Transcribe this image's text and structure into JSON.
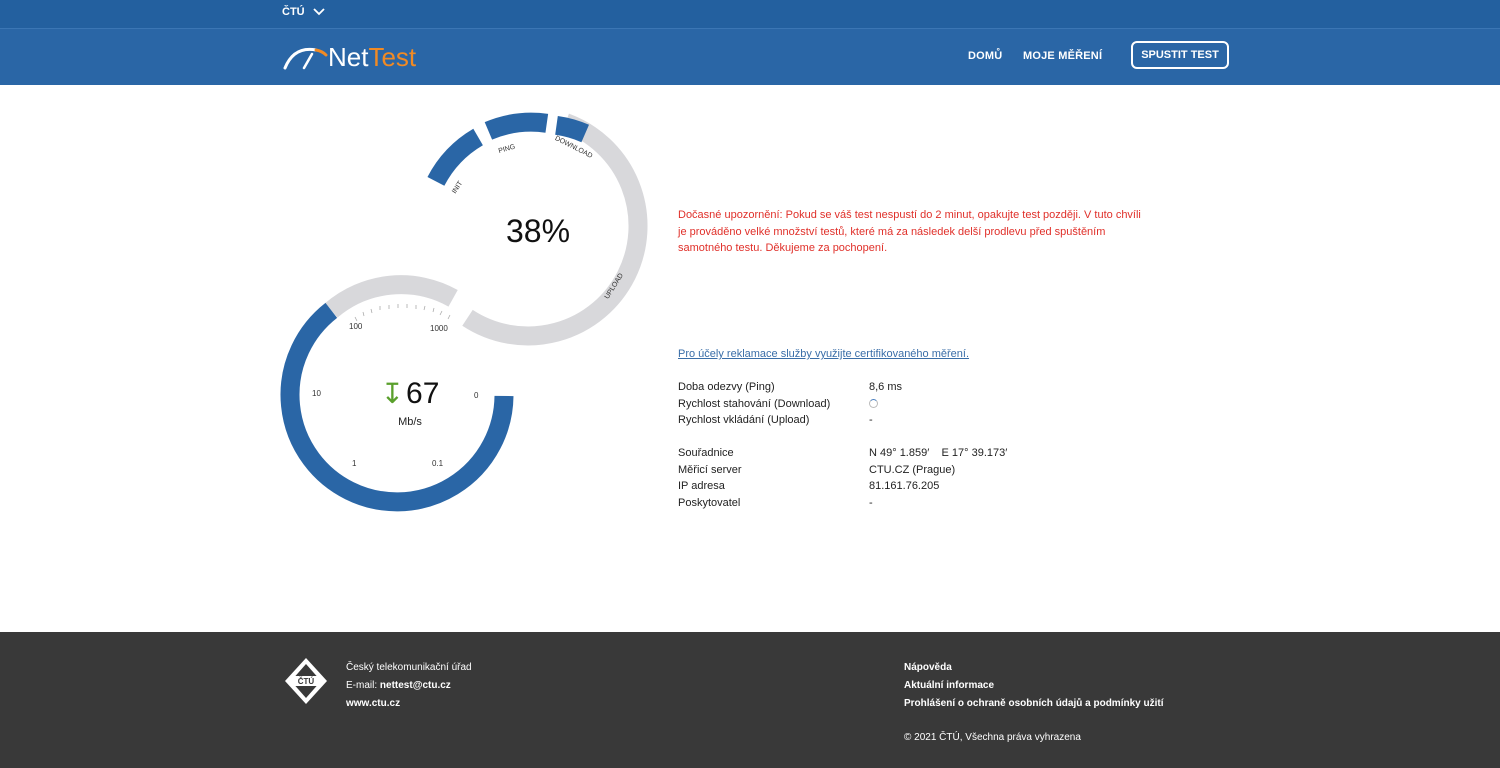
{
  "topbar": {
    "brand": "ČTÚ"
  },
  "navbar": {
    "logo_net": "Net",
    "logo_test": "Test",
    "links": {
      "home": "DOMŮ",
      "my_measurements": "MOJE MĚŘENÍ"
    },
    "run_button": "SPUSTIT TEST"
  },
  "progress_gauge": {
    "percent_text": "38%",
    "progress_fraction": 0.38,
    "phase_labels": {
      "init": "INIT",
      "ping": "PING",
      "download": "DOWNLOAD",
      "upload": "UPLOAD"
    }
  },
  "speed_gauge": {
    "value": "67",
    "unit": "Mb/s",
    "scale_labels": {
      "s1000": "1000",
      "s100": "100",
      "s10": "10",
      "s1": "1",
      "s01": "0.1",
      "s0": "0"
    }
  },
  "notice": "Dočasné upozornění: Pokud se váš test nespustí do 2 minut, opakujte test později. V tuto chvíli je prováděno velké množství testů, které má za následek delší prodlevu před spuštěním samotného testu. Děkujeme za pochopení.",
  "cert_link": "Pro účely reklamace služby využijte certifikovaného měření.",
  "results": {
    "ping_label": "Doba odezvy (Ping)",
    "ping_value": "8,6 ms",
    "download_label": "Rychlost stahování (Download)",
    "upload_label": "Rychlost vkládání (Upload)",
    "upload_value": "-"
  },
  "details": {
    "coords_label": "Souřadnice",
    "coords_value": "N 49° 1.859′    E 17° 39.173′",
    "server_label": "Měřicí server",
    "server_value": "CTU.CZ (Prague)",
    "ip_label": "IP adresa",
    "ip_value": "81.161.76.205",
    "provider_label": "Poskytovatel",
    "provider_value": "-"
  },
  "footer": {
    "logo_text": "ČTÚ",
    "org": "Český telekomunikační úřad",
    "email_label": "E-mail:",
    "email": "nettest@ctu.cz",
    "web": "www.ctu.cz",
    "links": {
      "help": "Nápověda",
      "news": "Aktuální informace",
      "privacy": "Prohlášení o ochraně osobních údajů a podmínky užití"
    },
    "copyright": "© 2021 ČTÚ, Všechna práva vyhrazena"
  },
  "colors": {
    "brand_blue": "#2a66a6",
    "gauge_blue": "#2a66a6",
    "gauge_gray": "#d8d8db",
    "accent_orange": "#f08a24",
    "notice_red": "#e0302a",
    "arrow_green": "#5aa02c",
    "footer_bg": "#393939"
  }
}
